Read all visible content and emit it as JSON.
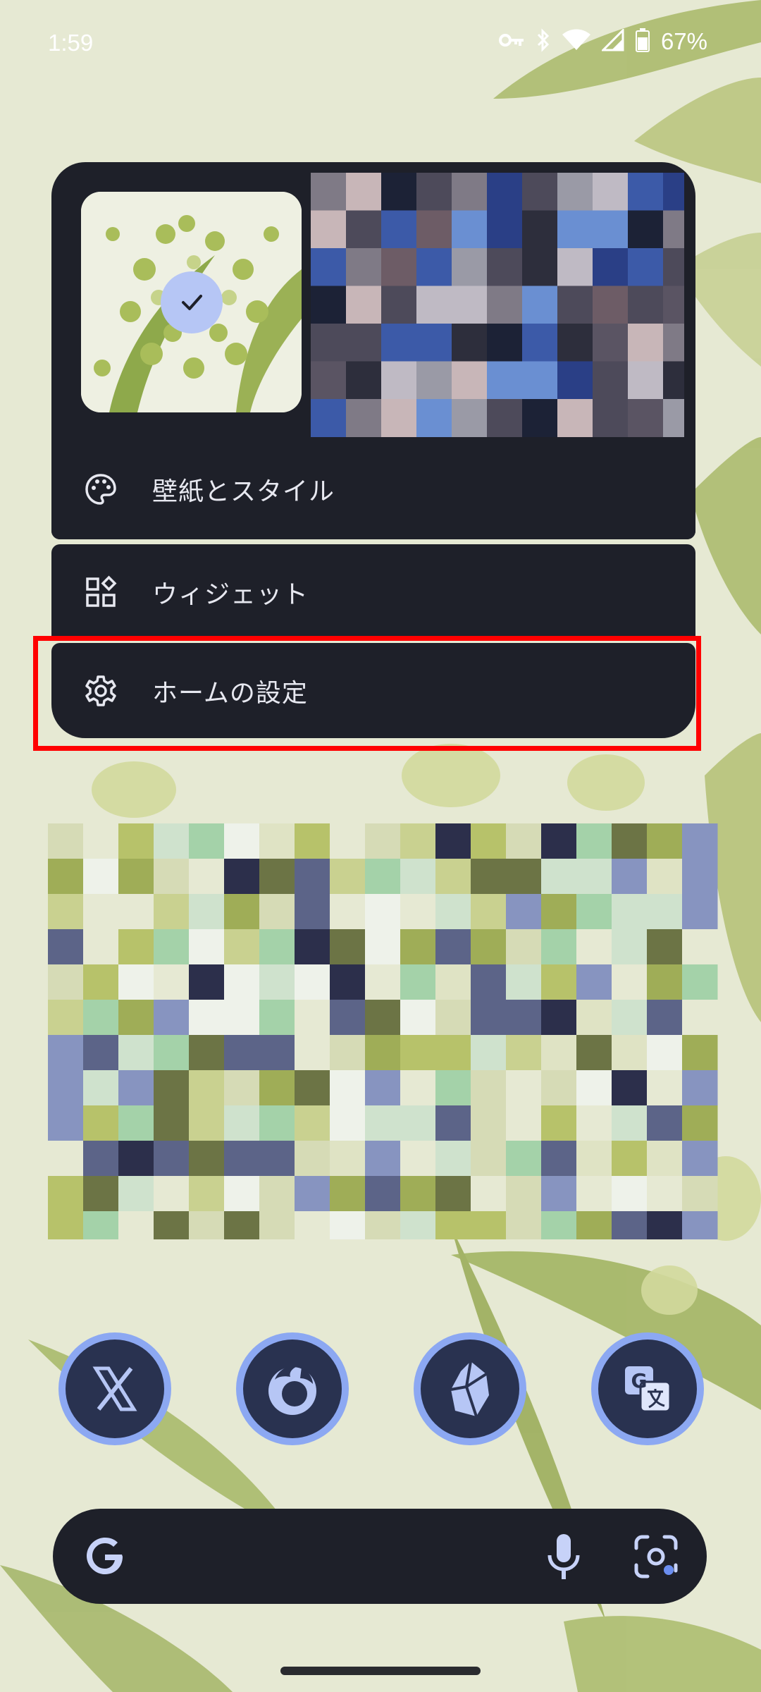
{
  "status_bar": {
    "time": "1:59",
    "battery_percent": "67%",
    "icons": [
      "vpn-key-icon",
      "bluetooth-icon",
      "wifi-icon",
      "cell-signal-icon",
      "battery-icon"
    ]
  },
  "popup_menu": {
    "items": [
      {
        "label": "壁紙とスタイル",
        "icon": "palette-icon"
      },
      {
        "label": "ウィジェット",
        "icon": "widgets-icon"
      },
      {
        "label": "ホームの設定",
        "icon": "gear-icon"
      }
    ],
    "highlighted_item": "ホームの設定"
  },
  "dock": {
    "apps": [
      {
        "name": "X",
        "icon": "x-logo-icon"
      },
      {
        "name": "Firefox",
        "icon": "firefox-icon"
      },
      {
        "name": "Obsidian",
        "icon": "obsidian-icon"
      },
      {
        "name": "Google Translate",
        "icon": "translate-icon"
      }
    ]
  },
  "search_bar": {
    "icons": [
      "google-g-icon",
      "microphone-icon",
      "google-lens-icon"
    ]
  },
  "colors": {
    "menu_bg": "#1e2029",
    "menu_text": "#e7e8f0",
    "accent": "#b6c6f5",
    "highlight": "#ff0000",
    "wallpaper_bg": "#e6e9d3"
  }
}
